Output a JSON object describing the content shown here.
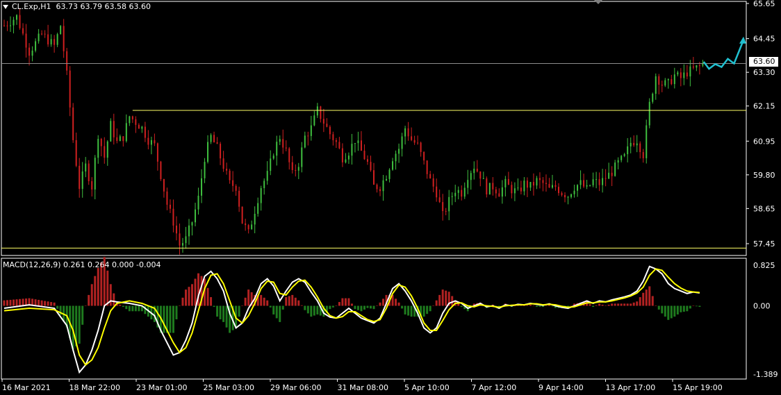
{
  "header": {
    "symbol": "CL.Exp,H1",
    "ohlc": "63.73 63.79 63.58 63.60"
  },
  "macd_header": {
    "label": "MACD(12,26,9) 0.261 0.264 0.000 -0.004"
  },
  "current_price_label": "63.60",
  "colors": {
    "background": "#000000",
    "bull": "#3fbf3f",
    "bear": "#d02020",
    "hline": "#ffff66",
    "current_line": "#8c8c8c",
    "macd_line": "#ffffff",
    "signal_line": "#ffff00",
    "hist_pos": "#b22222",
    "hist_neg": "#1e7a1e",
    "forecast": "#20c0d0",
    "axis": "#ffffff"
  },
  "chart_data": [
    {
      "type": "candlestick",
      "title": "CL.Exp,H1",
      "x_tick_labels": [
        "16 Mar 2021",
        "18 Mar 22:00",
        "23 Mar 01:00",
        "25 Mar 03:00",
        "29 Mar 06:00",
        "31 Mar 08:00",
        "5 Apr 10:00",
        "7 Apr 12:00",
        "9 Apr 14:00",
        "13 Apr 17:00",
        "15 Apr 19:00"
      ],
      "y_tick_labels": [
        "65.65",
        "64.45",
        "63.30",
        "62.15",
        "60.95",
        "59.80",
        "58.65",
        "57.45"
      ],
      "ylim": [
        57.2,
        65.65
      ],
      "current_price": 63.6,
      "horizontal_levels": [
        62.0,
        57.3
      ],
      "path": [
        [
          0,
          64.9
        ],
        [
          4,
          65.2
        ],
        [
          8,
          64.0
        ],
        [
          12,
          64.6
        ],
        [
          16,
          64.2
        ],
        [
          18,
          64.9
        ],
        [
          20,
          63.2
        ],
        [
          22,
          61.0
        ],
        [
          24,
          59.4
        ],
        [
          26,
          60.1
        ],
        [
          28,
          59.4
        ],
        [
          30,
          61.2
        ],
        [
          32,
          60.4
        ],
        [
          34,
          61.5
        ],
        [
          36,
          60.9
        ],
        [
          38,
          61.1
        ],
        [
          40,
          61.8
        ],
        [
          42,
          61.6
        ],
        [
          44,
          61.4
        ],
        [
          46,
          61.0
        ],
        [
          48,
          60.8
        ],
        [
          50,
          59.8
        ],
        [
          52,
          58.8
        ],
        [
          54,
          58.2
        ],
        [
          56,
          57.4
        ],
        [
          58,
          57.6
        ],
        [
          60,
          58.2
        ],
        [
          62,
          59.0
        ],
        [
          64,
          60.4
        ],
        [
          66,
          61.1
        ],
        [
          68,
          60.7
        ],
        [
          70,
          60.1
        ],
        [
          72,
          59.5
        ],
        [
          74,
          59.4
        ],
        [
          76,
          58.2
        ],
        [
          78,
          57.8
        ],
        [
          80,
          58.6
        ],
        [
          82,
          59.4
        ],
        [
          84,
          59.8
        ],
        [
          86,
          60.6
        ],
        [
          88,
          61.1
        ],
        [
          90,
          60.6
        ],
        [
          92,
          59.8
        ],
        [
          94,
          60.2
        ],
        [
          96,
          61.1
        ],
        [
          98,
          61.4
        ],
        [
          100,
          62.0
        ],
        [
          102,
          61.6
        ],
        [
          104,
          61.2
        ],
        [
          106,
          60.9
        ],
        [
          108,
          60.4
        ],
        [
          110,
          60.6
        ],
        [
          112,
          61.0
        ],
        [
          114,
          60.6
        ],
        [
          116,
          60.2
        ],
        [
          118,
          59.4
        ],
        [
          120,
          59.4
        ],
        [
          122,
          59.8
        ],
        [
          124,
          60.4
        ],
        [
          126,
          60.7
        ],
        [
          128,
          61.4
        ],
        [
          130,
          61.0
        ],
        [
          132,
          60.8
        ],
        [
          134,
          60.2
        ],
        [
          136,
          59.6
        ],
        [
          138,
          59.2
        ],
        [
          140,
          58.4
        ],
        [
          142,
          58.9
        ],
        [
          144,
          59.3
        ],
        [
          146,
          59.2
        ],
        [
          148,
          59.8
        ],
        [
          150,
          60.1
        ],
        [
          152,
          59.8
        ],
        [
          154,
          59.3
        ],
        [
          156,
          59.4
        ],
        [
          158,
          59.2
        ],
        [
          160,
          59.5
        ],
        [
          162,
          59.3
        ],
        [
          164,
          59.2
        ],
        [
          166,
          59.5
        ],
        [
          168,
          59.4
        ],
        [
          170,
          59.6
        ],
        [
          172,
          59.5
        ],
        [
          174,
          59.3
        ],
        [
          176,
          59.4
        ],
        [
          178,
          59.2
        ],
        [
          180,
          59.1
        ],
        [
          182,
          59.4
        ],
        [
          184,
          59.5
        ],
        [
          186,
          59.3
        ],
        [
          188,
          59.6
        ],
        [
          190,
          59.5
        ],
        [
          192,
          59.7
        ],
        [
          194,
          59.9
        ],
        [
          196,
          60.2
        ],
        [
          198,
          60.4
        ],
        [
          200,
          60.9
        ],
        [
          202,
          61.0
        ],
        [
          204,
          60.5
        ],
        [
          206,
          62.2
        ],
        [
          208,
          63.2
        ],
        [
          210,
          62.9
        ],
        [
          212,
          62.9
        ],
        [
          214,
          63.2
        ],
        [
          216,
          63.1
        ],
        [
          218,
          63.3
        ],
        [
          220,
          63.4
        ],
        [
          222,
          63.5
        ],
        [
          223,
          63.6
        ]
      ],
      "forecast_points": [
        [
          223.3,
          63.66
        ],
        [
          225,
          63.42
        ],
        [
          227,
          63.58
        ],
        [
          229,
          63.48
        ],
        [
          231,
          63.76
        ],
        [
          233,
          63.6
        ],
        [
          236,
          64.4
        ]
      ]
    },
    {
      "type": "macd",
      "title": "MACD(12,26,9) 0.261 0.264 0.000 -0.004",
      "y_tick_labels": [
        "0.825",
        "0.00",
        "-1.389"
      ],
      "ylim": [
        -1.389,
        0.825
      ],
      "macd_path": [
        [
          0,
          -0.05
        ],
        [
          8,
          0.02
        ],
        [
          16,
          -0.05
        ],
        [
          20,
          -0.4
        ],
        [
          22,
          -0.9
        ],
        [
          24,
          -1.35
        ],
        [
          26,
          -1.2
        ],
        [
          28,
          -0.9
        ],
        [
          30,
          -0.5
        ],
        [
          32,
          0.0
        ],
        [
          34,
          0.1
        ],
        [
          36,
          0.08
        ],
        [
          40,
          0.05
        ],
        [
          44,
          0.0
        ],
        [
          48,
          -0.2
        ],
        [
          50,
          -0.5
        ],
        [
          54,
          -1.0
        ],
        [
          56,
          -0.95
        ],
        [
          58,
          -0.7
        ],
        [
          60,
          -0.35
        ],
        [
          62,
          0.2
        ],
        [
          64,
          0.6
        ],
        [
          66,
          0.7
        ],
        [
          68,
          0.55
        ],
        [
          70,
          0.3
        ],
        [
          72,
          -0.15
        ],
        [
          74,
          -0.45
        ],
        [
          76,
          -0.35
        ],
        [
          78,
          -0.05
        ],
        [
          80,
          0.15
        ],
        [
          82,
          0.45
        ],
        [
          84,
          0.55
        ],
        [
          86,
          0.4
        ],
        [
          88,
          0.1
        ],
        [
          90,
          0.3
        ],
        [
          92,
          0.48
        ],
        [
          94,
          0.55
        ],
        [
          96,
          0.48
        ],
        [
          98,
          0.28
        ],
        [
          100,
          0.1
        ],
        [
          102,
          -0.15
        ],
        [
          104,
          -0.23
        ],
        [
          106,
          -0.25
        ],
        [
          108,
          -0.15
        ],
        [
          110,
          -0.05
        ],
        [
          112,
          -0.15
        ],
        [
          114,
          -0.25
        ],
        [
          116,
          -0.3
        ],
        [
          118,
          -0.35
        ],
        [
          120,
          -0.25
        ],
        [
          122,
          0.05
        ],
        [
          124,
          0.35
        ],
        [
          126,
          0.45
        ],
        [
          128,
          0.3
        ],
        [
          130,
          0.1
        ],
        [
          132,
          -0.15
        ],
        [
          134,
          -0.45
        ],
        [
          136,
          -0.55
        ],
        [
          138,
          -0.45
        ],
        [
          140,
          -0.15
        ],
        [
          142,
          0.05
        ],
        [
          144,
          0.1
        ],
        [
          146,
          0.05
        ],
        [
          148,
          -0.05
        ],
        [
          150,
          0.0
        ],
        [
          152,
          0.05
        ],
        [
          154,
          -0.02
        ],
        [
          156,
          0.0
        ],
        [
          158,
          -0.05
        ],
        [
          160,
          0.02
        ],
        [
          162,
          0.0
        ],
        [
          164,
          0.03
        ],
        [
          166,
          0.02
        ],
        [
          168,
          0.05
        ],
        [
          170,
          0.03
        ],
        [
          172,
          0.01
        ],
        [
          174,
          0.04
        ],
        [
          176,
          0.0
        ],
        [
          178,
          -0.03
        ],
        [
          180,
          -0.05
        ],
        [
          182,
          0.0
        ],
        [
          184,
          0.05
        ],
        [
          186,
          0.1
        ],
        [
          188,
          0.05
        ],
        [
          190,
          0.1
        ],
        [
          192,
          0.08
        ],
        [
          194,
          0.12
        ],
        [
          196,
          0.15
        ],
        [
          198,
          0.18
        ],
        [
          200,
          0.22
        ],
        [
          202,
          0.3
        ],
        [
          204,
          0.5
        ],
        [
          206,
          0.8
        ],
        [
          208,
          0.75
        ],
        [
          210,
          0.65
        ],
        [
          212,
          0.45
        ],
        [
          214,
          0.35
        ],
        [
          216,
          0.3
        ],
        [
          218,
          0.25
        ],
        [
          220,
          0.28
        ],
        [
          222,
          0.26
        ]
      ],
      "signal_path": [
        [
          0,
          -0.1
        ],
        [
          8,
          -0.05
        ],
        [
          16,
          -0.08
        ],
        [
          20,
          -0.2
        ],
        [
          22,
          -0.5
        ],
        [
          24,
          -1.0
        ],
        [
          26,
          -1.2
        ],
        [
          28,
          -1.1
        ],
        [
          30,
          -0.85
        ],
        [
          32,
          -0.45
        ],
        [
          34,
          -0.1
        ],
        [
          36,
          0.05
        ],
        [
          40,
          0.1
        ],
        [
          44,
          0.05
        ],
        [
          48,
          -0.05
        ],
        [
          50,
          -0.25
        ],
        [
          54,
          -0.75
        ],
        [
          56,
          -0.95
        ],
        [
          58,
          -0.85
        ],
        [
          60,
          -0.55
        ],
        [
          62,
          -0.1
        ],
        [
          64,
          0.35
        ],
        [
          66,
          0.62
        ],
        [
          68,
          0.65
        ],
        [
          70,
          0.45
        ],
        [
          72,
          0.1
        ],
        [
          74,
          -0.25
        ],
        [
          76,
          -0.35
        ],
        [
          78,
          -0.2
        ],
        [
          80,
          0.05
        ],
        [
          82,
          0.35
        ],
        [
          84,
          0.5
        ],
        [
          86,
          0.48
        ],
        [
          88,
          0.25
        ],
        [
          90,
          0.22
        ],
        [
          92,
          0.38
        ],
        [
          94,
          0.5
        ],
        [
          96,
          0.52
        ],
        [
          98,
          0.38
        ],
        [
          100,
          0.18
        ],
        [
          102,
          -0.05
        ],
        [
          104,
          -0.2
        ],
        [
          106,
          -0.25
        ],
        [
          108,
          -0.22
        ],
        [
          110,
          -0.12
        ],
        [
          112,
          -0.12
        ],
        [
          114,
          -0.2
        ],
        [
          116,
          -0.28
        ],
        [
          118,
          -0.32
        ],
        [
          120,
          -0.28
        ],
        [
          122,
          -0.05
        ],
        [
          124,
          0.25
        ],
        [
          126,
          0.42
        ],
        [
          128,
          0.38
        ],
        [
          130,
          0.2
        ],
        [
          132,
          -0.05
        ],
        [
          134,
          -0.35
        ],
        [
          136,
          -0.5
        ],
        [
          138,
          -0.5
        ],
        [
          140,
          -0.3
        ],
        [
          142,
          -0.08
        ],
        [
          144,
          0.05
        ],
        [
          146,
          0.06
        ],
        [
          148,
          0.0
        ],
        [
          150,
          -0.02
        ],
        [
          152,
          0.02
        ],
        [
          154,
          0.0
        ],
        [
          156,
          -0.01
        ],
        [
          158,
          -0.03
        ],
        [
          160,
          0.0
        ],
        [
          162,
          0.01
        ],
        [
          164,
          0.02
        ],
        [
          166,
          0.02
        ],
        [
          168,
          0.04
        ],
        [
          170,
          0.04
        ],
        [
          172,
          0.02
        ],
        [
          174,
          0.03
        ],
        [
          176,
          0.02
        ],
        [
          178,
          -0.01
        ],
        [
          180,
          -0.03
        ],
        [
          182,
          -0.02
        ],
        [
          184,
          0.02
        ],
        [
          186,
          0.06
        ],
        [
          188,
          0.06
        ],
        [
          190,
          0.08
        ],
        [
          192,
          0.08
        ],
        [
          194,
          0.1
        ],
        [
          196,
          0.13
        ],
        [
          198,
          0.16
        ],
        [
          200,
          0.2
        ],
        [
          202,
          0.26
        ],
        [
          204,
          0.38
        ],
        [
          206,
          0.62
        ],
        [
          208,
          0.75
        ],
        [
          210,
          0.72
        ],
        [
          212,
          0.58
        ],
        [
          214,
          0.45
        ],
        [
          216,
          0.36
        ],
        [
          218,
          0.3
        ],
        [
          220,
          0.28
        ],
        [
          222,
          0.27
        ]
      ]
    }
  ]
}
